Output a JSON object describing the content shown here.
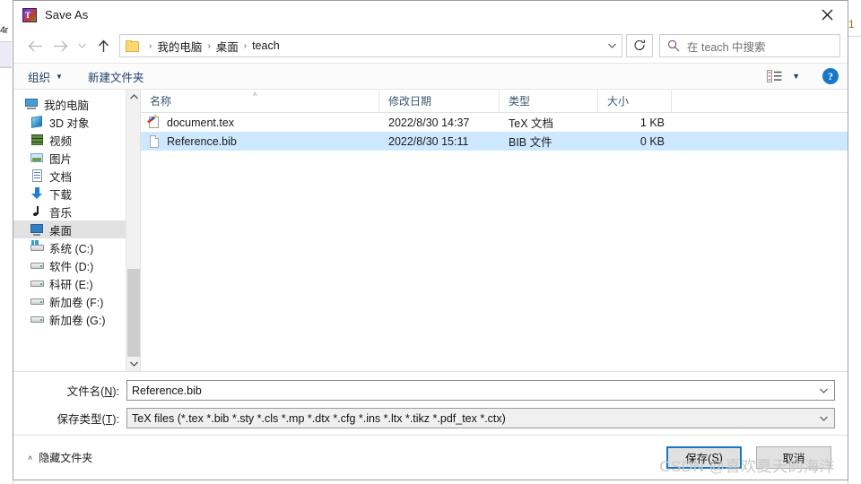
{
  "background": {
    "left_fragment": "4r",
    "right_fragment": "1"
  },
  "window": {
    "title": "Save As",
    "app_icon": "tex-app-icon",
    "close_label": "✕"
  },
  "nav": {
    "back_icon": "arrow-left-icon",
    "forward_icon": "arrow-right-icon",
    "recent_icon": "chevron-down-icon",
    "up_icon": "arrow-up-icon",
    "breadcrumb": {
      "folder_icon": "folder-icon",
      "separator": "›",
      "items": [
        "我的电脑",
        "桌面",
        "teach"
      ],
      "dropdown_icon": "chevron-down-icon"
    },
    "refresh_icon": "refresh-icon",
    "search": {
      "icon": "search-icon",
      "placeholder": "在 teach 中搜索",
      "value": ""
    }
  },
  "commandbar": {
    "organize_label": "组织",
    "organize_caret": "▼",
    "new_folder_label": "新建文件夹",
    "view_icon": "view-layout-icon",
    "view_caret": "▼",
    "help_icon": "help-icon",
    "help_glyph": "?"
  },
  "sidebar": {
    "items": [
      {
        "label": "我的电脑",
        "icon": "computer-icon",
        "level": 0,
        "selected": false
      },
      {
        "label": "3D 对象",
        "icon": "3d-objects-icon",
        "level": 1,
        "selected": false
      },
      {
        "label": "视频",
        "icon": "videos-icon",
        "level": 1,
        "selected": false
      },
      {
        "label": "图片",
        "icon": "pictures-icon",
        "level": 1,
        "selected": false
      },
      {
        "label": "文档",
        "icon": "documents-icon",
        "level": 1,
        "selected": false
      },
      {
        "label": "下载",
        "icon": "downloads-icon",
        "level": 1,
        "selected": false
      },
      {
        "label": "音乐",
        "icon": "music-icon",
        "level": 1,
        "selected": false
      },
      {
        "label": "桌面",
        "icon": "desktop-icon",
        "level": 1,
        "selected": true
      },
      {
        "label": "系统 (C:)",
        "icon": "system-drive-icon",
        "level": 1,
        "selected": false
      },
      {
        "label": "软件 (D:)",
        "icon": "drive-icon",
        "level": 1,
        "selected": false
      },
      {
        "label": "科研 (E:)",
        "icon": "drive-icon",
        "level": 1,
        "selected": false
      },
      {
        "label": "新加卷 (F:)",
        "icon": "drive-icon",
        "level": 1,
        "selected": false
      },
      {
        "label": "新加卷 (G:)",
        "icon": "drive-icon",
        "level": 1,
        "selected": false
      }
    ],
    "scroll_up_icon": "▲",
    "scroll_down_icon": "▼"
  },
  "filelist": {
    "columns": [
      "名称",
      "修改日期",
      "类型",
      "大小"
    ],
    "sort_indicator": "˄",
    "rows": [
      {
        "name": "document.tex",
        "icon": "tex-file-icon",
        "date": "2022/8/30 14:37",
        "type": "TeX 文档",
        "size": "1 KB",
        "selected": false
      },
      {
        "name": "Reference.bib",
        "icon": "blank-file-icon",
        "date": "2022/8/30 15:11",
        "type": "BIB 文件",
        "size": "0 KB",
        "selected": true
      }
    ]
  },
  "form": {
    "filename_label_pre": "文件名(",
    "filename_label_key": "N",
    "filename_label_post": "):",
    "filename_value": "Reference.bib",
    "filetype_label_pre": "保存类型(",
    "filetype_label_key": "T",
    "filetype_label_post": "):",
    "filetype_value": "TeX files (*.tex *.bib *.sty *.cls *.mp *.dtx *.cfg *.ins *.ltx *.tikz *.pdf_tex *.ctx)",
    "dropdown_icon": "chevron-down-icon"
  },
  "footer": {
    "hide_folders_caret": "˄",
    "hide_folders_label": "隐藏文件夹",
    "save_label_pre": "保存(",
    "save_label_key": "S",
    "save_label_post": ")",
    "cancel_label": "取消"
  },
  "watermark": {
    "text": "CSDN @喜欢夏天的海洋"
  },
  "colors": {
    "accent": "#1878c8",
    "selection": "#cde8ff",
    "link": "#1f3d6b",
    "sidebar_selected": "#e2e2e2"
  }
}
